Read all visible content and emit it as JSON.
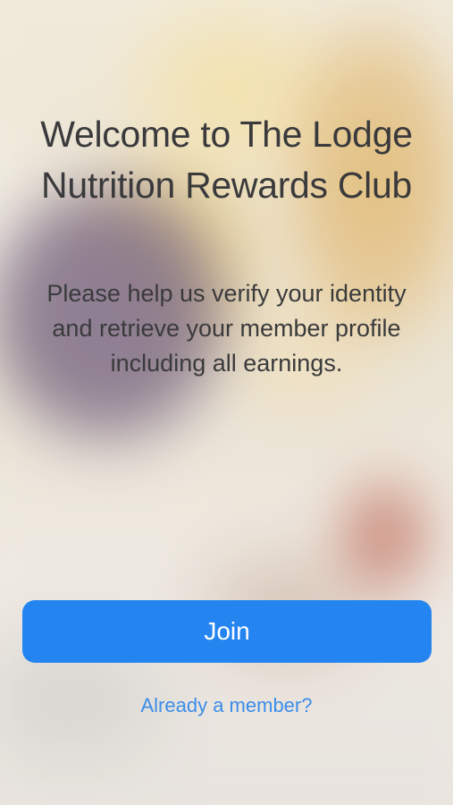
{
  "welcome": {
    "title": "Welcome to The Lodge Nutrition Rewards Club",
    "description": "Please help us verify your identity and retrieve your member profile including all earnings."
  },
  "actions": {
    "join_label": "Join",
    "member_link_label": "Already a member?"
  },
  "colors": {
    "accent": "#2585f0",
    "link": "#3b8dea",
    "text": "#3a3a3c"
  }
}
